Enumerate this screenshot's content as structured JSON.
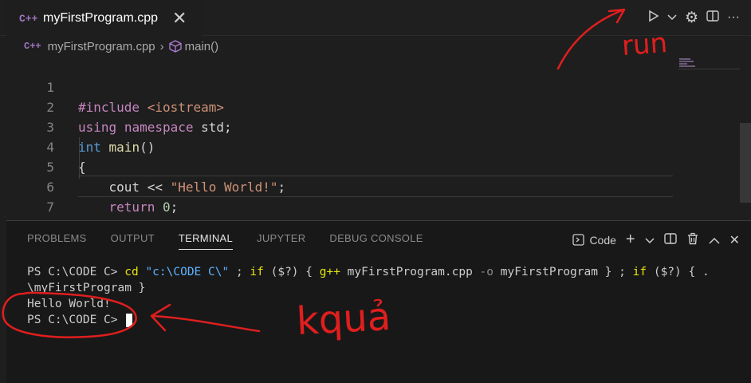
{
  "tab": {
    "icon": "cpp-file-icon",
    "title": "myFirstProgram.cpp",
    "close": "✕"
  },
  "tab_actions": {
    "run": "▷",
    "run_menu": "⌄",
    "settings": "⚙",
    "split": "⊟",
    "more": "···"
  },
  "breadcrumb": {
    "file": "myFirstProgram.cpp",
    "symbol": "main()"
  },
  "code_lines": [
    {
      "num": "1"
    },
    {
      "num": "2"
    },
    {
      "num": "3"
    },
    {
      "num": "4"
    },
    {
      "num": "5"
    },
    {
      "num": "6"
    },
    {
      "num": "7"
    }
  ],
  "code": {
    "l1_kw": "#include",
    "l1_inc": "<iostream>",
    "l2_kw1": "using",
    "l2_kw2": "namespace",
    "l2_id": "std;",
    "l3_type": "int",
    "l3_fn": "main",
    "l3_paren": "()",
    "l4": "{",
    "l5_id": "cout",
    "l5_op": "<<",
    "l5_str": "\"Hello World!\"",
    "l5_semi": ";",
    "l6_kw": "return",
    "l6_num": "0",
    "l6_semi": ";",
    "l7": "}"
  },
  "panel": {
    "tabs": [
      "PROBLEMS",
      "OUTPUT",
      "TERMINAL",
      "JUPYTER",
      "DEBUG CONSOLE"
    ],
    "active_tab": "TERMINAL",
    "shell_label": "Code",
    "actions": {
      "new": "+",
      "new_menu": "⌄",
      "split": "⊟",
      "trash": "🗑",
      "maximize": "^",
      "close": "✕"
    }
  },
  "terminal": {
    "prompt": "PS C:\\CODE C>",
    "cmd_cd": "cd",
    "cd_path": "\"c:\\CODE C\\\"",
    "sep1": ";",
    "if1": "if",
    "cond1": "($?)",
    "brace_open1": "{",
    "gpp": "g++",
    "src": "myFirstProgram.cpp",
    "flag_o": "-o",
    "out": "myFirstProgram",
    "brace_close1": "}",
    "sep2": ";",
    "if2": "if",
    "cond2": "($?)",
    "brace_open2": "{ .",
    "exec_line": "\\myFirstProgram }",
    "output": "Hello World!",
    "prompt2": "PS C:\\CODE C>"
  },
  "annotations": {
    "run_note": "run",
    "result_note": "kquả"
  },
  "colors": {
    "annotation": "#e01e1e",
    "background": "#1e1e1e",
    "panel": "#181818"
  }
}
